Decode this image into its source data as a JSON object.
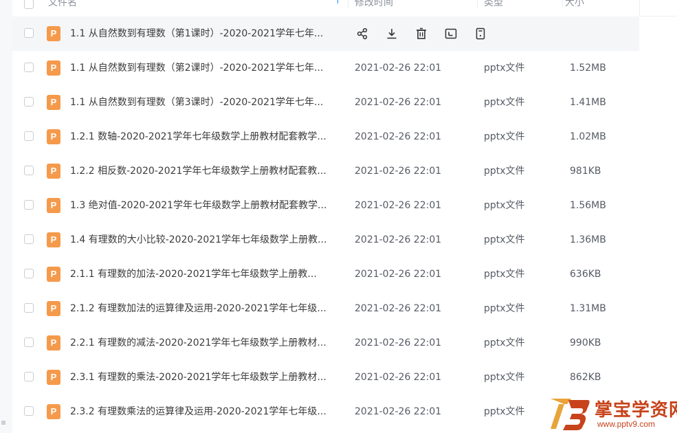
{
  "header": {
    "name_label": "文件名",
    "time_label": "修改时间",
    "type_label": "类型",
    "size_label": "大小",
    "sort_icon": "sort-arrow-up-icon"
  },
  "actions": [
    "share-icon",
    "download-icon",
    "delete-icon",
    "rename-icon",
    "more-icon"
  ],
  "file_icon_letter": "P",
  "files": [
    {
      "name": "1.1 从自然数到有理数（第1课时）-2020-2021学年七年...",
      "time": "",
      "type": "",
      "size": "",
      "hovered": true
    },
    {
      "name": "1.1 从自然数到有理数（第2课时）-2020-2021学年七年...",
      "time": "2021-02-26 22:01",
      "type": "pptx文件",
      "size": "1.52MB"
    },
    {
      "name": "1.1 从自然数到有理数（第3课时）-2020-2021学年七年...",
      "time": "2021-02-26 22:01",
      "type": "pptx文件",
      "size": "1.41MB"
    },
    {
      "name": "1.2.1 数轴-2020-2021学年七年级数学上册教材配套教学...",
      "time": "2021-02-26 22:01",
      "type": "pptx文件",
      "size": "1.02MB"
    },
    {
      "name": "1.2.2 相反数-2020-2021学年七年级数学上册教材配套教...",
      "time": "2021-02-26 22:01",
      "type": "pptx文件",
      "size": "981KB"
    },
    {
      "name": "1.3 绝对值-2020-2021学年七年级数学上册教材配套教学...",
      "time": "2021-02-26 22:01",
      "type": "pptx文件",
      "size": "1.56MB"
    },
    {
      "name": "1.4 有理数的大小比较-2020-2021学年七年级数学上册教...",
      "time": "2021-02-26 22:01",
      "type": "pptx文件",
      "size": "1.36MB"
    },
    {
      "name": "2.1.1  有理数的加法-2020-2021学年七年级数学上册教...",
      "time": "2021-02-26 22:01",
      "type": "pptx文件",
      "size": "636KB"
    },
    {
      "name": "2.1.2 有理数加法的运算律及运用-2020-2021学年七年级...",
      "time": "2021-02-26 22:01",
      "type": "pptx文件",
      "size": "1.31MB"
    },
    {
      "name": "2.2.1 有理数的减法-2020-2021学年七年级数学上册教材...",
      "time": "2021-02-26 22:01",
      "type": "pptx文件",
      "size": "990KB"
    },
    {
      "name": "2.3.1 有理数的乘法-2020-2021学年七年级数学上册教材...",
      "time": "2021-02-26 22:01",
      "type": "pptx文件",
      "size": "862KB"
    },
    {
      "name": "2.3.2 有理数乘法的运算律及运用-2020-2021学年七年级...",
      "time": "2021-02-26 22:01",
      "type": "pptx文件",
      "size": ""
    }
  ],
  "watermark": {
    "title": "掌宝学资网",
    "url": "www.pptv9.com"
  },
  "colors": {
    "file_icon": "#f59a4b",
    "accent": "#1a8cff",
    "watermark": "#c8431b"
  }
}
